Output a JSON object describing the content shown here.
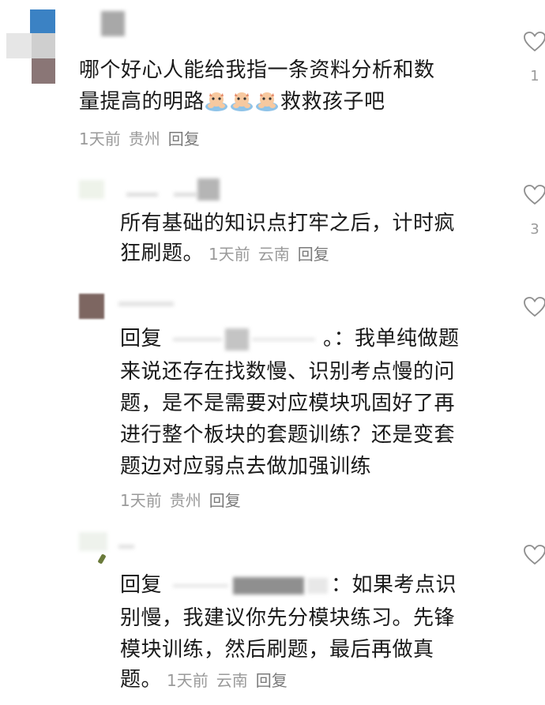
{
  "comments": [
    {
      "line1": "哪个好心人能给我指一条资料分析和数",
      "line2_pre": "量提高的明路",
      "line2_emojis": [
        "cat-paw-emoji",
        "cat-paw-emoji",
        "cat-paw-emoji"
      ],
      "line2_post": "救救孩子吧",
      "time": "1天前",
      "location": "贵州",
      "reply": "回复",
      "likes": "1",
      "icon": "heart-outline-icon"
    },
    {
      "line1": "所有基础的知识点打牢之后，计时疯",
      "line2": "狂刷题。",
      "time": "1天前",
      "location": "云南",
      "reply": "回复",
      "likes": "3",
      "icon": "heart-outline-icon"
    },
    {
      "reply_prefix": "回复",
      "line1_post": "。：我单纯做题",
      "line2": "来说还存在找数慢、识别考点慢的问",
      "line3": "题，是不是需要对应模块巩固好了再",
      "line4": "进行整个板块的套题训练？还是变套",
      "line5": "题边对应弱点去做加强训练",
      "time": "1天前",
      "location": "贵州",
      "reply": "回复",
      "icon": "heart-outline-icon"
    },
    {
      "reply_prefix": "回复",
      "line1_post": "：如果考点识",
      "line2": "别慢，我建议你先分模块练习。先锋",
      "line3": "模块训练，然后刷题，最后再做真",
      "line4": "题。",
      "time": "1天前",
      "location": "云南",
      "reply": "回复",
      "icon": "heart-outline-icon"
    }
  ],
  "colors": {
    "text": "#1a1a1a",
    "meta": "#9a9a9a",
    "avatar_blue": "#3b82c4"
  }
}
